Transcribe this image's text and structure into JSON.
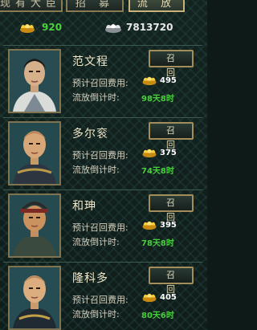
{
  "tabs": [
    {
      "label": "现有大臣",
      "active": false
    },
    {
      "label": "招 募",
      "active": false
    },
    {
      "label": "流 放",
      "active": true
    }
  ],
  "resources": {
    "gold": "920",
    "silver": "7813720",
    "gold_icon": "gold-ingot-icon",
    "silver_icon": "silver-ingot-icon"
  },
  "recall_button_label": "召 回",
  "cost_label": "预计召回费用:",
  "countdown_label": "流放倒计时:",
  "ministers": [
    {
      "name": "范文程",
      "cost": "495",
      "countdown": "98天8时"
    },
    {
      "name": "多尔衮",
      "cost": "375",
      "countdown": "74天8时"
    },
    {
      "name": "和珅",
      "cost": "395",
      "countdown": "78天8时"
    },
    {
      "name": "隆科多",
      "cost": "405",
      "countdown": "80天6时"
    }
  ],
  "colors": {
    "value_green": "#49cf3d",
    "gold": "#f2c02a",
    "frame": "#7f744f"
  }
}
